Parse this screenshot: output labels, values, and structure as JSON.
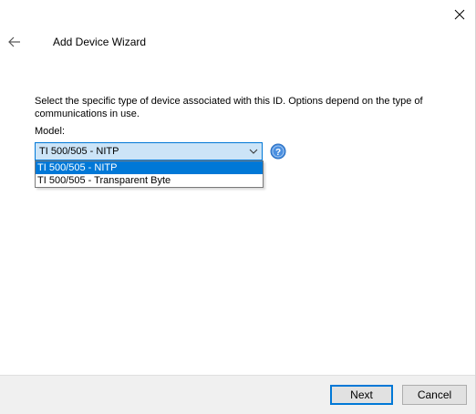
{
  "window": {
    "title": "Add Device Wizard",
    "close_icon": "close-icon",
    "back_icon": "back-arrow-icon"
  },
  "main": {
    "description": "Select the specific type of device associated with this ID. Options depend on the type of communications in use.",
    "model_label": "Model:",
    "model_select": {
      "selected_value": "TI 500/505 - NITP",
      "options": [
        "TI 500/505 - NITP",
        "TI 500/505 - Transparent Byte"
      ],
      "arrow_icon": "chevron-down-icon"
    },
    "help_icon": "help-icon"
  },
  "footer": {
    "next_label": "Next",
    "cancel_label": "Cancel"
  },
  "colors": {
    "accent": "#0078d7",
    "combo_bg": "#cce4f7",
    "footer_bg": "#f0f0f0",
    "help_blue": "#4a8fe0"
  }
}
